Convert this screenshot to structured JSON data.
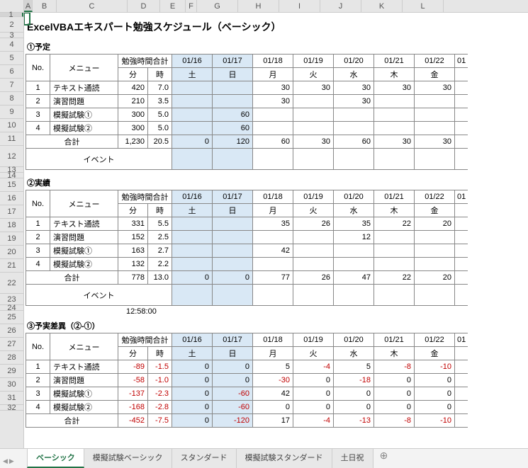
{
  "title": "ExcelVBAエキスパート勉強スケジュール（ベーシック）",
  "columns": [
    "A",
    "B",
    "C",
    "D",
    "E",
    "F",
    "G",
    "H",
    "I",
    "J",
    "K",
    "L"
  ],
  "rows": [
    "1",
    "2",
    "3",
    "4",
    "5",
    "6",
    "7",
    "8",
    "9",
    "10",
    "11",
    "12",
    "13",
    "14",
    "15",
    "16",
    "17",
    "18",
    "19",
    "20",
    "21",
    "22",
    "23",
    "24",
    "25",
    "26",
    "27",
    "28",
    "29",
    "30",
    "31",
    "32"
  ],
  "cutoff_date": "01",
  "time_below": "12:58:00",
  "sections": [
    {
      "label": "①予定",
      "header1": {
        "no": "No.",
        "menu": "メニュー",
        "totals": "勉強時間合計"
      },
      "header2": {
        "min": "分",
        "hr": "時"
      },
      "dates": [
        "01/16",
        "01/17",
        "01/18",
        "01/19",
        "01/20",
        "01/21",
        "01/22"
      ],
      "days": [
        "土",
        "日",
        "月",
        "火",
        "水",
        "木",
        "金"
      ],
      "weekend": [
        true,
        true,
        false,
        false,
        false,
        false,
        false
      ],
      "rows": [
        {
          "no": "1",
          "menu": "テキスト通読",
          "min": "420",
          "hr": "7.0",
          "cells": [
            "",
            "",
            "30",
            "30",
            "30",
            "30",
            "30"
          ]
        },
        {
          "no": "2",
          "menu": "演習問題",
          "min": "210",
          "hr": "3.5",
          "cells": [
            "",
            "",
            "30",
            "",
            "30",
            "",
            ""
          ]
        },
        {
          "no": "3",
          "menu": "模擬試験①",
          "min": "300",
          "hr": "5.0",
          "cells": [
            "",
            "60",
            "",
            "",
            "",
            "",
            ""
          ]
        },
        {
          "no": "4",
          "menu": "模擬試験②",
          "min": "300",
          "hr": "5.0",
          "cells": [
            "",
            "60",
            "",
            "",
            "",
            "",
            ""
          ]
        }
      ],
      "total": {
        "label": "合計",
        "min": "1,230",
        "hr": "20.5",
        "cells": [
          "0",
          "120",
          "60",
          "30",
          "60",
          "30",
          "30"
        ]
      },
      "event": {
        "label": "イベント",
        "cells": [
          "",
          "",
          "",
          "",
          "",
          "",
          ""
        ]
      }
    },
    {
      "label": "②実績",
      "header1": {
        "no": "No.",
        "menu": "メニュー",
        "totals": "勉強時間合計"
      },
      "header2": {
        "min": "分",
        "hr": "時"
      },
      "dates": [
        "01/16",
        "01/17",
        "01/18",
        "01/19",
        "01/20",
        "01/21",
        "01/22"
      ],
      "days": [
        "土",
        "日",
        "月",
        "火",
        "水",
        "木",
        "金"
      ],
      "weekend": [
        true,
        true,
        false,
        false,
        false,
        false,
        false
      ],
      "rows": [
        {
          "no": "1",
          "menu": "テキスト通読",
          "min": "331",
          "hr": "5.5",
          "cells": [
            "",
            "",
            "35",
            "26",
            "35",
            "22",
            "20"
          ]
        },
        {
          "no": "2",
          "menu": "演習問題",
          "min": "152",
          "hr": "2.5",
          "cells": [
            "",
            "",
            "",
            "",
            "12",
            "",
            ""
          ]
        },
        {
          "no": "3",
          "menu": "模擬試験①",
          "min": "163",
          "hr": "2.7",
          "cells": [
            "",
            "",
            "42",
            "",
            "",
            "",
            ""
          ]
        },
        {
          "no": "4",
          "menu": "模擬試験②",
          "min": "132",
          "hr": "2.2",
          "cells": [
            "",
            "",
            "",
            "",
            "",
            "",
            ""
          ]
        }
      ],
      "total": {
        "label": "合計",
        "min": "778",
        "hr": "13.0",
        "cells": [
          "0",
          "0",
          "77",
          "26",
          "47",
          "22",
          "20"
        ]
      },
      "event": {
        "label": "イベント",
        "cells": [
          "",
          "",
          "",
          "",
          "",
          "",
          ""
        ]
      }
    },
    {
      "label": "③予実差異（②-①）",
      "header1": {
        "no": "No.",
        "menu": "メニュー",
        "totals": "勉強時間合計"
      },
      "header2": {
        "min": "分",
        "hr": "時"
      },
      "dates": [
        "01/16",
        "01/17",
        "01/18",
        "01/19",
        "01/20",
        "01/21",
        "01/22"
      ],
      "days": [
        "土",
        "日",
        "月",
        "火",
        "水",
        "木",
        "金"
      ],
      "weekend": [
        true,
        true,
        false,
        false,
        false,
        false,
        false
      ],
      "rows": [
        {
          "no": "1",
          "menu": "テキスト通読",
          "min": "-89",
          "hr": "-1.5",
          "cells": [
            "0",
            "0",
            "5",
            "-4",
            "5",
            "-8",
            "-10"
          ]
        },
        {
          "no": "2",
          "menu": "演習問題",
          "min": "-58",
          "hr": "-1.0",
          "cells": [
            "0",
            "0",
            "-30",
            "0",
            "-18",
            "0",
            "0"
          ]
        },
        {
          "no": "3",
          "menu": "模擬試験①",
          "min": "-137",
          "hr": "-2.3",
          "cells": [
            "0",
            "-60",
            "42",
            "0",
            "0",
            "0",
            "0"
          ]
        },
        {
          "no": "4",
          "menu": "模擬試験②",
          "min": "-168",
          "hr": "-2.8",
          "cells": [
            "0",
            "-60",
            "0",
            "0",
            "0",
            "0",
            "0"
          ]
        }
      ],
      "total": {
        "label": "合計",
        "min": "-452",
        "hr": "-7.5",
        "cells": [
          "0",
          "-120",
          "17",
          "-4",
          "-13",
          "-8",
          "-10"
        ]
      }
    }
  ],
  "tabs": [
    "ベーシック",
    "模擬試験ベーシック",
    "スタンダード",
    "模擬試験スタンダード",
    "土日祝"
  ],
  "active_tab": 0
}
